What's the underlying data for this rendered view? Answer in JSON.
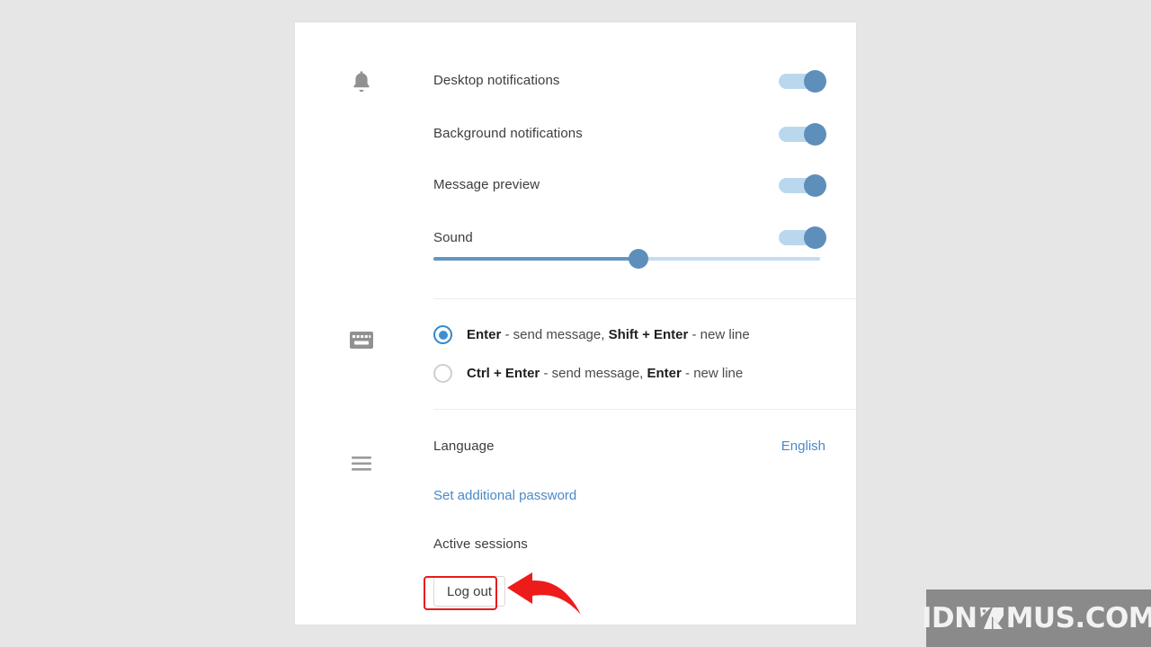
{
  "app": {
    "background_color": "#e6e6e6",
    "panel_color": "#ffffff",
    "accent_color": "#5d8fba",
    "link_color": "#4a89c7",
    "annotation_color": "#e81b1b"
  },
  "notifications": {
    "icon": "bell-icon",
    "items": [
      {
        "label": "Desktop notifications",
        "state": "on"
      },
      {
        "label": "Background notifications",
        "state": "on"
      },
      {
        "label": "Message preview",
        "state": "on"
      },
      {
        "label": "Sound",
        "state": "on"
      }
    ],
    "volume": {
      "name": "sound-volume-slider",
      "percent": 53
    }
  },
  "send_keys": {
    "icon": "keyboard-icon",
    "options": [
      {
        "selected": true,
        "parts": [
          {
            "text": "Enter",
            "bold": true
          },
          {
            "text": " - send message, ",
            "bold": false
          },
          {
            "text": "Shift + Enter",
            "bold": true
          },
          {
            "text": " - new line",
            "bold": false
          }
        ]
      },
      {
        "selected": false,
        "parts": [
          {
            "text": "Ctrl + Enter",
            "bold": true
          },
          {
            "text": " - send message, ",
            "bold": false
          },
          {
            "text": "Enter",
            "bold": true
          },
          {
            "text": " - new line",
            "bold": false
          }
        ]
      }
    ]
  },
  "general": {
    "icon": "hamburger-icon",
    "language_label": "Language",
    "language_value": "English",
    "set_password_link": "Set additional password",
    "active_sessions_label": "Active sessions",
    "logout_label": "Log out"
  },
  "watermark": {
    "prefix": "IDN",
    "mark": "k-logo-icon",
    "suffix": "MUS.COM"
  }
}
